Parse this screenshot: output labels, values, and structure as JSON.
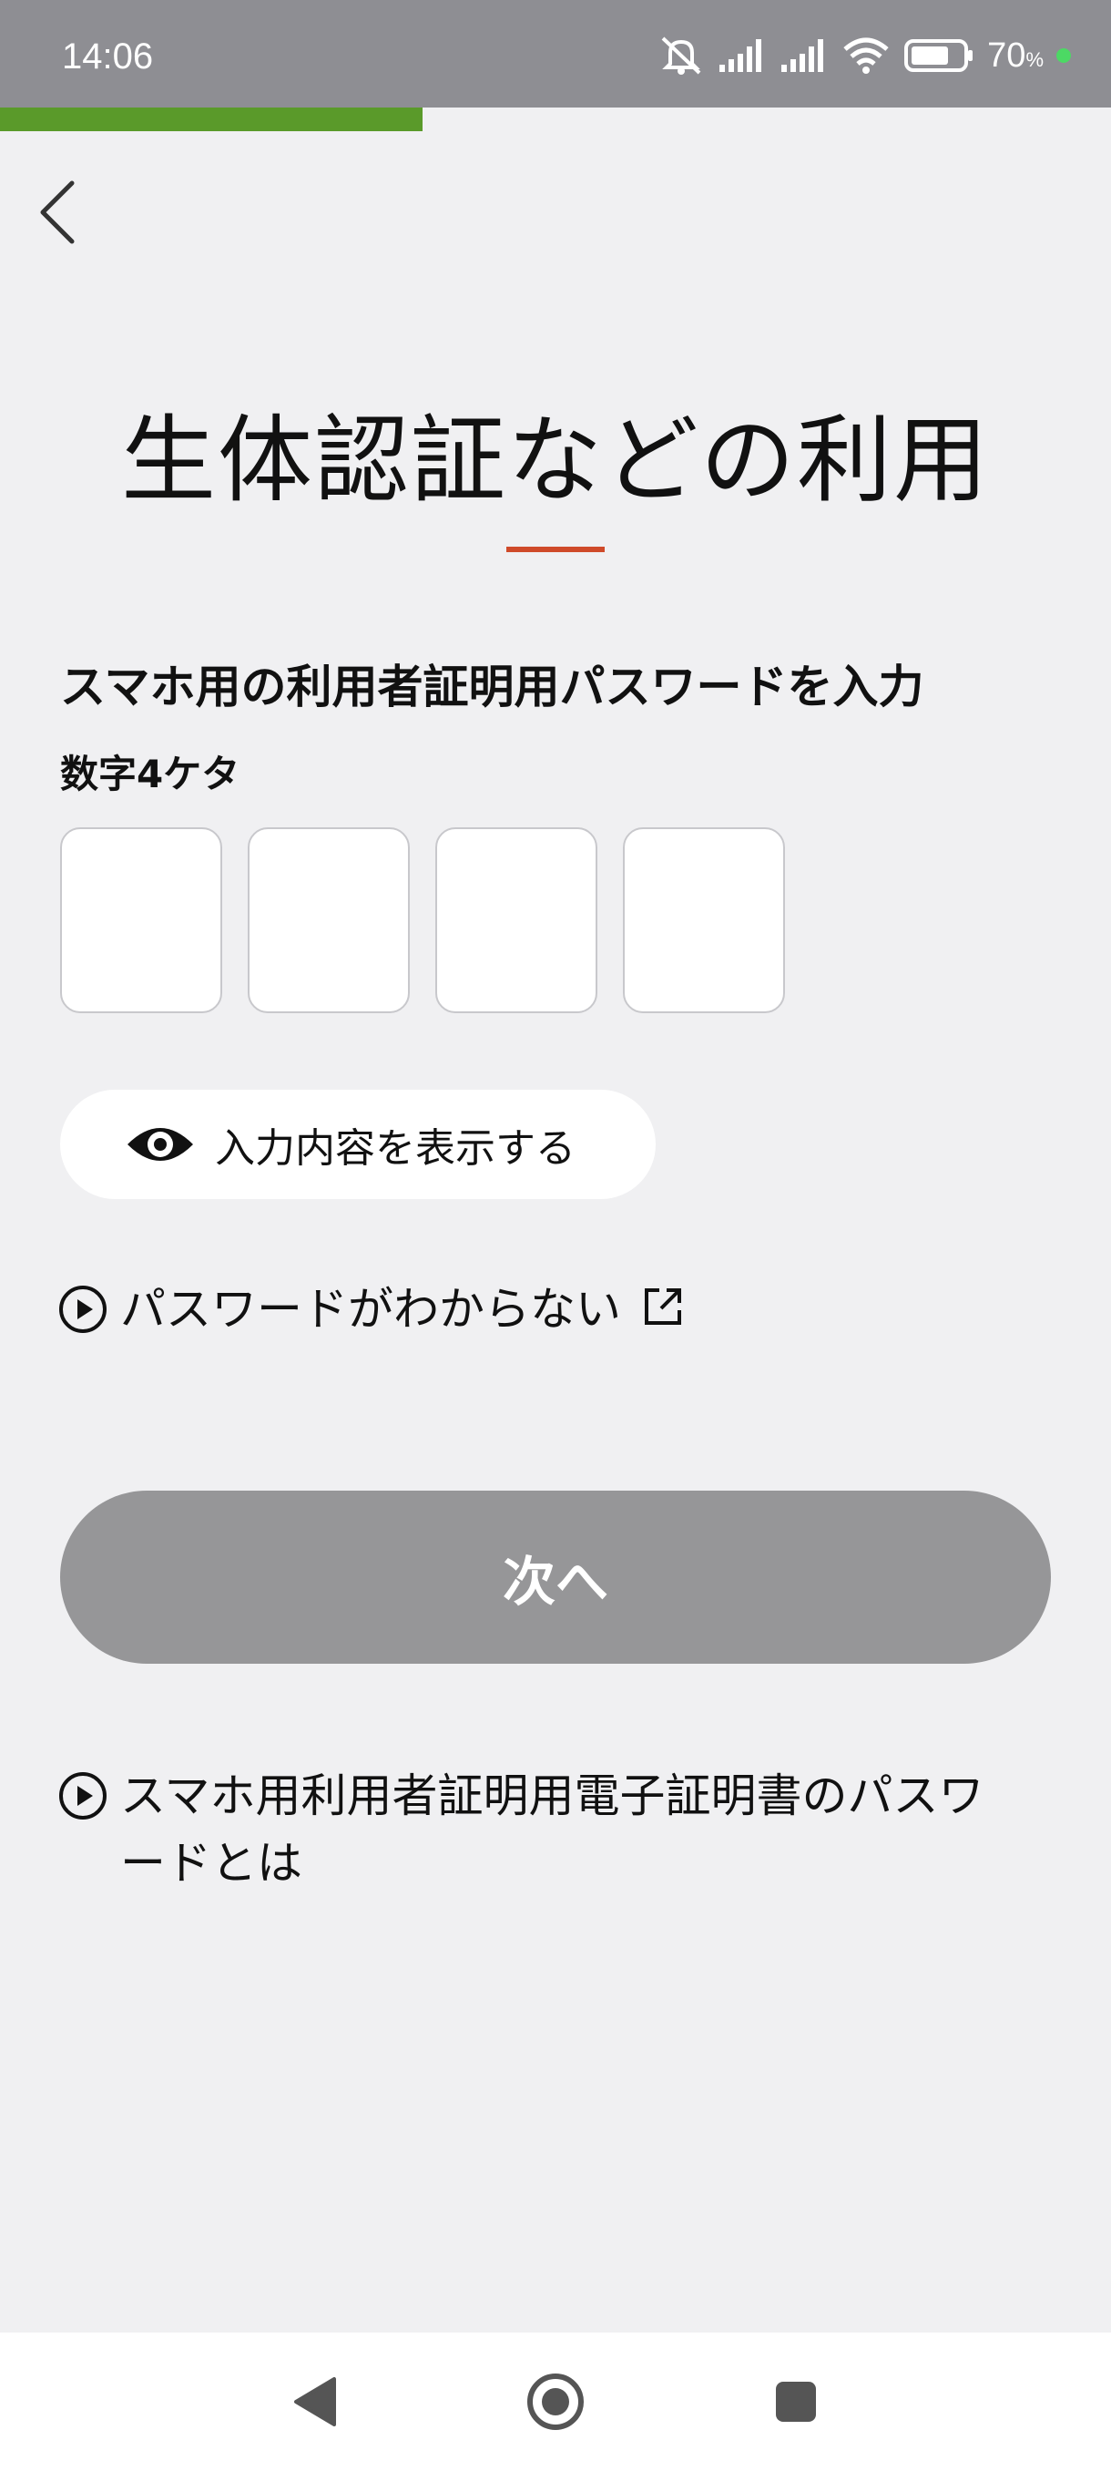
{
  "status_bar": {
    "time": "14:06",
    "battery_percent": "70",
    "battery_unit": "%",
    "icons": [
      "mute-icon",
      "signal-icon",
      "signal-icon",
      "wifi-icon",
      "battery-icon"
    ]
  },
  "progress": {
    "fraction": 0.38,
    "color": "#5a9a2a"
  },
  "page": {
    "title": "生体認証などの利用",
    "accent_color": "#cf4a2a"
  },
  "form": {
    "section_label": "スマホ用の利用者証明用パスワードを入力",
    "digits_label": "数字4ケタ",
    "pin_boxes": [
      "",
      "",
      "",
      ""
    ],
    "show_button_label": "入力内容を表示する"
  },
  "links": {
    "forgot_password": "パスワードがわからない",
    "about_password": "スマホ用利用者証明用電子証明書のパスワードとは"
  },
  "next_button": {
    "label": "次へ",
    "state": "disabled"
  },
  "nav": {
    "icons": [
      "back-icon",
      "home-icon",
      "recents-icon"
    ]
  }
}
